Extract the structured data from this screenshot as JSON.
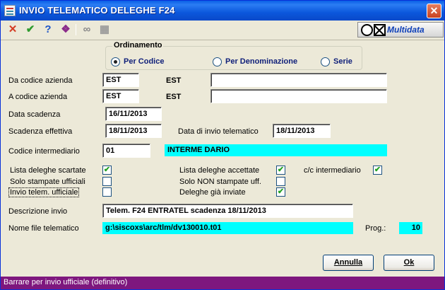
{
  "window": {
    "title": "INVIO TELEMATICO DELEGHE F24",
    "close_glyph": "✕"
  },
  "toolbar": {
    "icons": [
      {
        "name": "cancel-icon",
        "glyph": "✕",
        "color": "#d43c23"
      },
      {
        "name": "confirm-icon",
        "glyph": "✔",
        "color": "#2f9b2f"
      },
      {
        "name": "help-icon",
        "glyph": "?",
        "color": "#1e56c8"
      },
      {
        "name": "book-icon",
        "glyph": "❖",
        "color": "#8a2a8a"
      },
      {
        "name": "binoculars-icon",
        "glyph": "∞",
        "color": "#888888"
      },
      {
        "name": "calculator-icon",
        "glyph": "▦",
        "color": "#9a9a9a"
      }
    ],
    "brand": "Multidata"
  },
  "ordinamento": {
    "title": "Ordinamento",
    "options": [
      {
        "label": "Per Codice",
        "selected": true
      },
      {
        "label": "Per Denominazione",
        "selected": false
      },
      {
        "label": "Serie",
        "selected": false
      }
    ]
  },
  "form": {
    "da_codice_label": "Da codice azienda",
    "da_codice_value": "EST",
    "da_codice_desc": "EST",
    "da_codice_name": "",
    "a_codice_label": "A codice azienda",
    "a_codice_value": "EST",
    "a_codice_desc": "EST",
    "a_codice_name": "",
    "data_scadenza_label": "Data scadenza",
    "data_scadenza_value": "16/11/2013",
    "scadenza_effettiva_label": "Scadenza effettiva",
    "scadenza_effettiva_value": "18/11/2013",
    "data_invio_label": "Data di invio telematico",
    "data_invio_value": "18/11/2013",
    "codice_intermediario_label": "Codice intermediario",
    "codice_intermediario_value": "01",
    "intermediario_name": "INTERME DARIO",
    "descrizione_label": "Descrizione invio",
    "descrizione_value": "Telem. F24 ENTRATEL scadenza 18/11/2013",
    "nome_file_label": "Nome file telematico",
    "nome_file_value": "g:\\siscoxs\\arc/tlm/dv130010.t01",
    "prog_label": "Prog.:",
    "prog_value": "10"
  },
  "checkboxes": [
    {
      "label": "Lista deleghe scartate",
      "checked": true
    },
    {
      "label": "Solo stampate ufficiali",
      "checked": false
    },
    {
      "label": "Invio telem. ufficiale",
      "checked": false
    },
    {
      "label": "Lista deleghe accettate",
      "checked": true
    },
    {
      "label": "Solo NON stampate uff.",
      "checked": false
    },
    {
      "label": "Deleghe già inviate",
      "checked": true
    },
    {
      "label": "c/c intermediario",
      "checked": true
    }
  ],
  "buttons": {
    "annulla": "Annulla",
    "ok": "Ok"
  },
  "status": "Barrare per invio ufficiale (definitivo)",
  "colors": {
    "highlight": "#00ffff",
    "status_bar": "#7e177e",
    "titlebar": "#0a5fe6"
  }
}
